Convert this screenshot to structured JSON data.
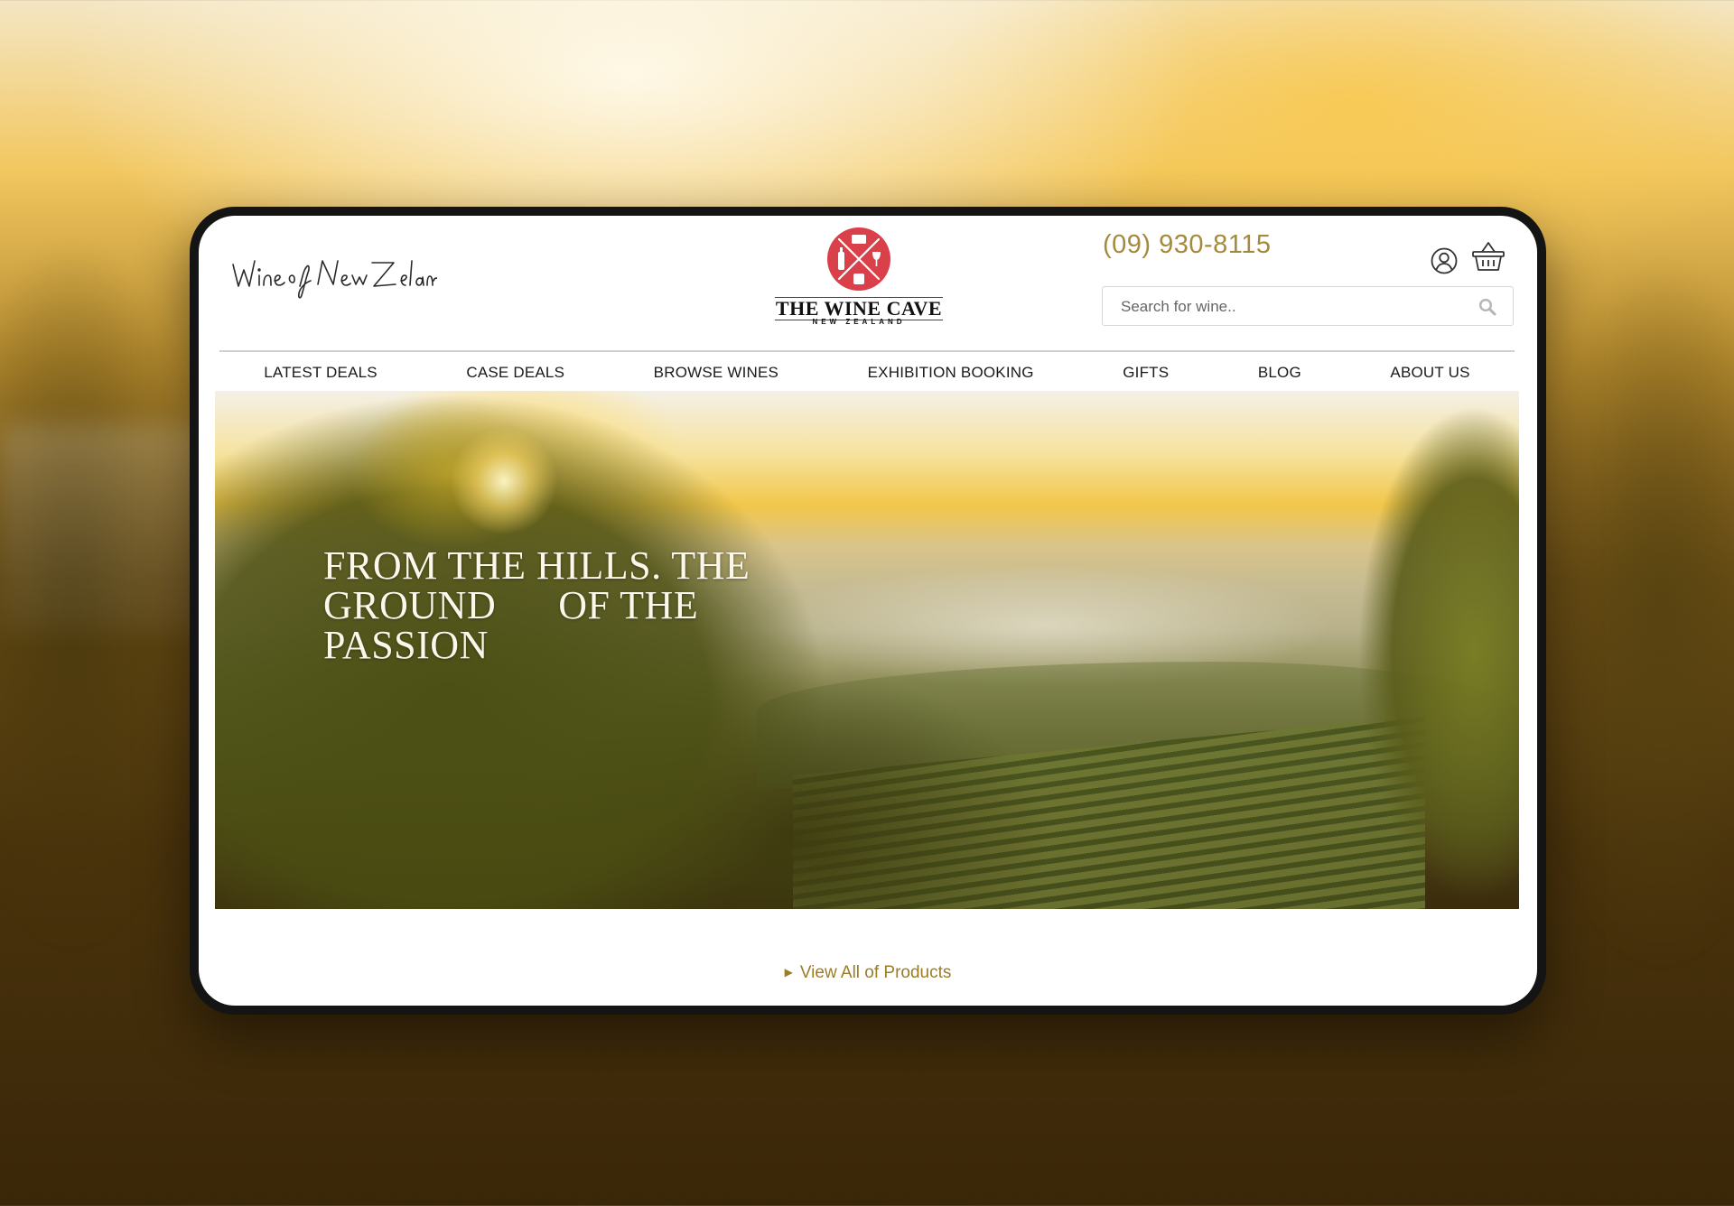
{
  "brand": {
    "tagline": "Wine of New Zealand",
    "name": "THE WINE CAVE",
    "subname": "NEW ZEALAND",
    "emblem_color": "#d9404a"
  },
  "header": {
    "phone": "(09) 930-8115",
    "search_placeholder": "Search for wine..",
    "accent_color": "#a48a3a"
  },
  "nav": {
    "items": [
      {
        "label": "LATEST DEALS"
      },
      {
        "label": "CASE DEALS"
      },
      {
        "label": "BROWSE WINES"
      },
      {
        "label": "EXHIBITION BOOKING"
      },
      {
        "label": "GIFTS"
      },
      {
        "label": "BLOG"
      },
      {
        "label": "ABOUT US"
      }
    ]
  },
  "hero": {
    "headline_lines": [
      "FROM THE HILLS. THE",
      "GROUND      OF THE",
      "PASSION"
    ]
  },
  "footer_link": {
    "label": "View All of Products",
    "icon": "caret-right-icon"
  }
}
